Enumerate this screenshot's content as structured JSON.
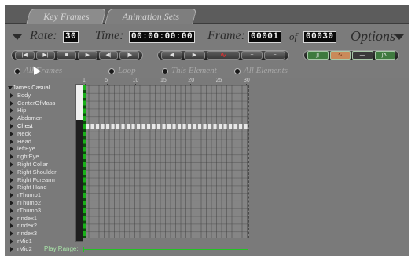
{
  "tabs": [
    {
      "label": "Key Frames",
      "active": true
    },
    {
      "label": "Animation Sets",
      "active": false
    }
  ],
  "header": {
    "rate_label": "Rate:",
    "rate_value": "30",
    "time_label": "Time:",
    "time_value": "00:00:00:00",
    "frame_label": "Frame:",
    "frame_value": "00001",
    "of_label": "of",
    "total_frames": "00030",
    "options_label": "Options"
  },
  "transport_buttons": [
    "|◀",
    "▶|",
    "■",
    "▶",
    "◀|",
    "|▶"
  ],
  "key_buttons": [
    "◀",
    "▶",
    "∿",
    "+",
    "−"
  ],
  "interp_buttons": [
    "∫∫",
    "∿",
    "—",
    "∫∿"
  ],
  "radios": {
    "all_frames": "All Frames",
    "loop": "Loop",
    "this_element": "This Element",
    "all_elements": "All Elements"
  },
  "ruler_ticks": [
    "1",
    "5",
    "10",
    "15",
    "20",
    "25",
    "30"
  ],
  "tree": {
    "root": "James Casual",
    "items": [
      "Body",
      "CenterOfMass",
      "Hip",
      "Abdomen",
      "Chest",
      "Neck",
      "Head",
      "leftEye",
      "rightEye",
      "Right Collar",
      "Right Shoulder",
      "Right Forearm",
      "Right Hand",
      "rThumb1",
      "rThumb2",
      "rThumb3",
      "rIndex1",
      "rIndex2",
      "rIndex3",
      "rMid1",
      "rMid2"
    ],
    "selected": "Chest"
  },
  "play_range_label": "Play Range:",
  "colors": {
    "keyframe_green": "#18b018",
    "range_green": "#22c422",
    "interp_active": "#c98a5a"
  }
}
